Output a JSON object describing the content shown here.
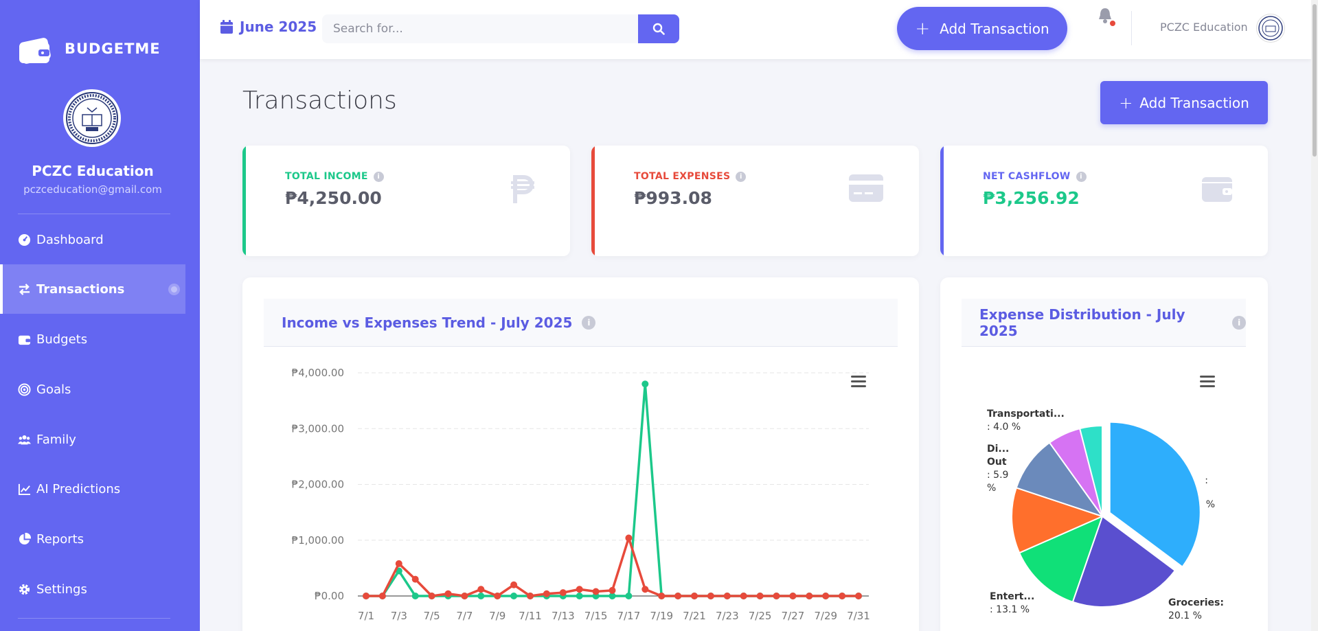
{
  "app": {
    "name": "BUDGETME"
  },
  "profile": {
    "name": "PCZC Education",
    "email": "pczceducation@gmail.com"
  },
  "sidebar": {
    "items": [
      {
        "label": "Dashboard",
        "icon": "dashboard-gauge-icon"
      },
      {
        "label": "Transactions",
        "icon": "exchange-arrows-icon",
        "active": true
      },
      {
        "label": "Budgets",
        "icon": "wallet-icon"
      },
      {
        "label": "Goals",
        "icon": "target-icon"
      },
      {
        "label": "Family",
        "icon": "users-icon"
      },
      {
        "label": "AI Predictions",
        "icon": "line-chart-icon"
      },
      {
        "label": "Reports",
        "icon": "pie-chart-icon"
      },
      {
        "label": "Settings",
        "icon": "gear-icon"
      }
    ]
  },
  "topbar": {
    "date": "June 2025",
    "search_placeholder": "Search for...",
    "add_label": "Add Transaction",
    "user_name": "PCZC Education"
  },
  "page": {
    "title": "Transactions",
    "add_label": "Add Transaction"
  },
  "stats": [
    {
      "label": "TOTAL INCOME",
      "value": "₱4,250.00",
      "color": "#1cc88a",
      "icon": "peso-icon"
    },
    {
      "label": "TOTAL EXPENSES",
      "value": "₱993.08",
      "color": "#e74a3b",
      "icon": "credit-card-icon"
    },
    {
      "label": "NET CASHFLOW",
      "value": "₱3,256.92",
      "color": "#6366f1",
      "icon": "wallet-icon"
    }
  ],
  "colors": {
    "primary": "#6366f1",
    "income": "#1cc88a",
    "expense": "#e74a3b"
  },
  "chart_data": [
    {
      "type": "line",
      "title": "Income vs Expenses Trend - July 2025",
      "x": [
        "7/1",
        "7/2",
        "7/3",
        "7/4",
        "7/5",
        "7/6",
        "7/7",
        "7/8",
        "7/9",
        "7/10",
        "7/11",
        "7/12",
        "7/13",
        "7/14",
        "7/15",
        "7/16",
        "7/17",
        "7/18",
        "7/19",
        "7/20",
        "7/21",
        "7/22",
        "7/23",
        "7/24",
        "7/25",
        "7/26",
        "7/27",
        "7/28",
        "7/29",
        "7/30",
        "7/31"
      ],
      "x_tick_labels": [
        "7/1",
        "7/3",
        "7/5",
        "7/7",
        "7/9",
        "7/11",
        "7/13",
        "7/15",
        "7/17",
        "7/19",
        "7/21",
        "7/23",
        "7/25",
        "7/27",
        "7/29",
        "7/31"
      ],
      "y_tick_labels": [
        "₱0.00",
        "₱1,000.00",
        "₱2,000.00",
        "₱3,000.00",
        "₱4,000.00"
      ],
      "ylim": [
        0,
        4000
      ],
      "grid": true,
      "series": [
        {
          "color": "#1cc88a",
          "values": [
            0,
            0,
            450,
            0,
            0,
            0,
            0,
            0,
            0,
            0,
            0,
            0,
            0,
            0,
            0,
            0,
            0,
            3800,
            0,
            0,
            0,
            0,
            0,
            0,
            0,
            0,
            0,
            0,
            0,
            0,
            0
          ]
        },
        {
          "color": "#e74a3b",
          "values": [
            0,
            0,
            580,
            300,
            0,
            40,
            0,
            120,
            0,
            200,
            0,
            40,
            60,
            120,
            80,
            100,
            1040,
            120,
            0,
            0,
            0,
            0,
            0,
            0,
            0,
            0,
            0,
            0,
            0,
            0,
            0
          ]
        }
      ]
    },
    {
      "type": "pie",
      "title": "Expense Distribution - July 2025",
      "slices": [
        {
          "label": "",
          "value_text": ": %",
          "value": 35.2,
          "color": "#2eaefc"
        },
        {
          "label": "Groceries:",
          "value_text": "20.1 %",
          "value": 20.1,
          "color": "#5a4fcf"
        },
        {
          "label": "",
          "value_text": "",
          "value": 13.1,
          "color": "#10e078"
        },
        {
          "label": "Entert...",
          "value_text": ": 13.1 %",
          "value": 11.7,
          "color": "#ff6f2c"
        },
        {
          "label": "",
          "value_text": "",
          "value": 10.0,
          "color": "#6b8abb"
        },
        {
          "label": "Di...",
          "value_text": ": 5.9",
          "value": 5.9,
          "color": "#d673f3"
        },
        {
          "label": "Transportati...",
          "value_text": ": 4.0 %",
          "value": 4.0,
          "color": "#2ee0c8"
        }
      ],
      "labels": [
        {
          "text": "Transportati...",
          "bold": true
        },
        {
          "text": ": 4.0 %",
          "bold": false
        },
        {
          "text": "Di...",
          "bold": true
        },
        {
          "text": "Out",
          "bold": true
        },
        {
          "text": ": 5.9",
          "bold": false
        },
        {
          "text": "%",
          "bold": false
        },
        {
          "text": ":",
          "bold": false
        },
        {
          "text": "%",
          "bold": false
        },
        {
          "text": "Entert...",
          "bold": true
        },
        {
          "text": ": 13.1 %",
          "bold": false
        },
        {
          "text": "Groceries:",
          "bold": true
        },
        {
          "text": "20.1 %",
          "bold": false
        }
      ]
    }
  ]
}
